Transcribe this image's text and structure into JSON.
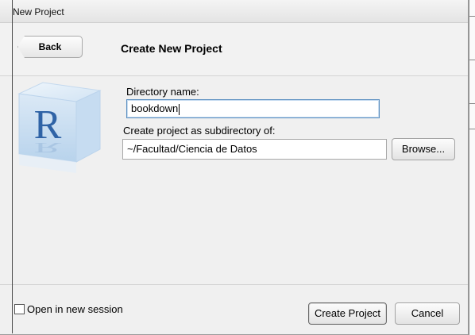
{
  "window": {
    "title": "New Project"
  },
  "header": {
    "back_label": "Back",
    "title": "Create New Project"
  },
  "form": {
    "directory_label": "Directory name:",
    "directory_value": "bookdown",
    "subdir_label": "Create project as subdirectory of:",
    "subdir_value": "~/Facultad/Ciencia de Datos",
    "browse_label": "Browse..."
  },
  "footer": {
    "open_new_session_label": "Open in new session",
    "open_new_session_checked": false,
    "create_label": "Create Project",
    "cancel_label": "Cancel"
  },
  "logo": {
    "letter": "R",
    "icon": "r-logo-cube-icon"
  }
}
